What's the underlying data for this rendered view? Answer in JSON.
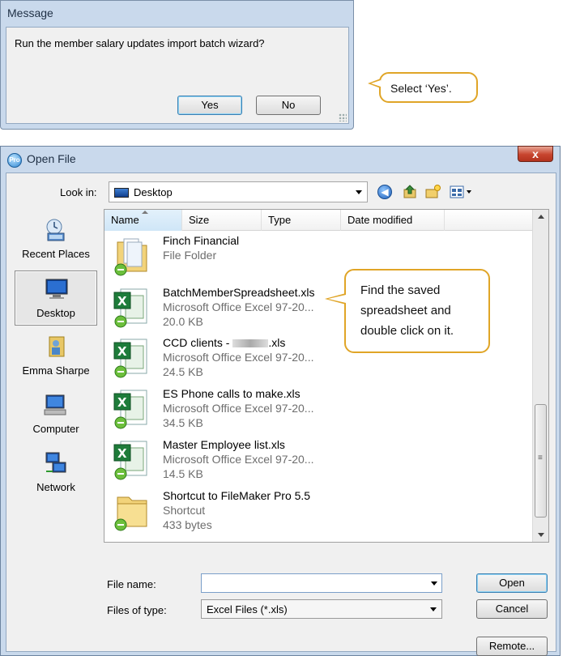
{
  "message_dialog": {
    "title": "Message",
    "text": "Run the member salary updates import batch wizard?",
    "yes_label": "Yes",
    "no_label": "No"
  },
  "callouts": {
    "select_yes": "Select ‘Yes’.",
    "find_line1": "Find the saved",
    "find_line2": "spreadsheet and",
    "find_line3": "double click on it."
  },
  "open_file": {
    "title": "Open File",
    "close_label": "x",
    "look_in_label": "Look in:",
    "look_in_value": "Desktop",
    "places": [
      {
        "label": "Recent Places"
      },
      {
        "label": "Desktop"
      },
      {
        "label": "Emma Sharpe"
      },
      {
        "label": "Computer"
      },
      {
        "label": "Network"
      }
    ],
    "columns": [
      "Name",
      "Size",
      "Type",
      "Date modified"
    ],
    "files": [
      {
        "name": "Finch Financial",
        "type": "File Folder",
        "size": ""
      },
      {
        "name": "BatchMemberSpreadsheet.xls",
        "type": "Microsoft Office Excel 97-20...",
        "size": "20.0 KB"
      },
      {
        "name_prefix": "CCD clients - ",
        "name_suffix": ".xls",
        "type": "Microsoft Office Excel 97-20...",
        "size": "24.5 KB"
      },
      {
        "name": "ES Phone calls to make.xls",
        "type": "Microsoft Office Excel 97-20...",
        "size": "34.5 KB"
      },
      {
        "name": "Master Employee list.xls",
        "type": "Microsoft Office Excel 97-20...",
        "size": "14.5 KB"
      },
      {
        "name": "Shortcut to FileMaker Pro 5.5",
        "type": "Shortcut",
        "size": "433 bytes"
      }
    ],
    "file_name_label": "File name:",
    "file_name_value": "",
    "files_of_type_label": "Files of type:",
    "files_of_type_value": "Excel Files (*.xls)",
    "open_label": "Open",
    "cancel_label": "Cancel",
    "remote_label": "Remote..."
  },
  "colors": {
    "callout_border": "#e0a527",
    "window_frame": "#c9d9ec",
    "excel_green": "#1e7c3a"
  }
}
